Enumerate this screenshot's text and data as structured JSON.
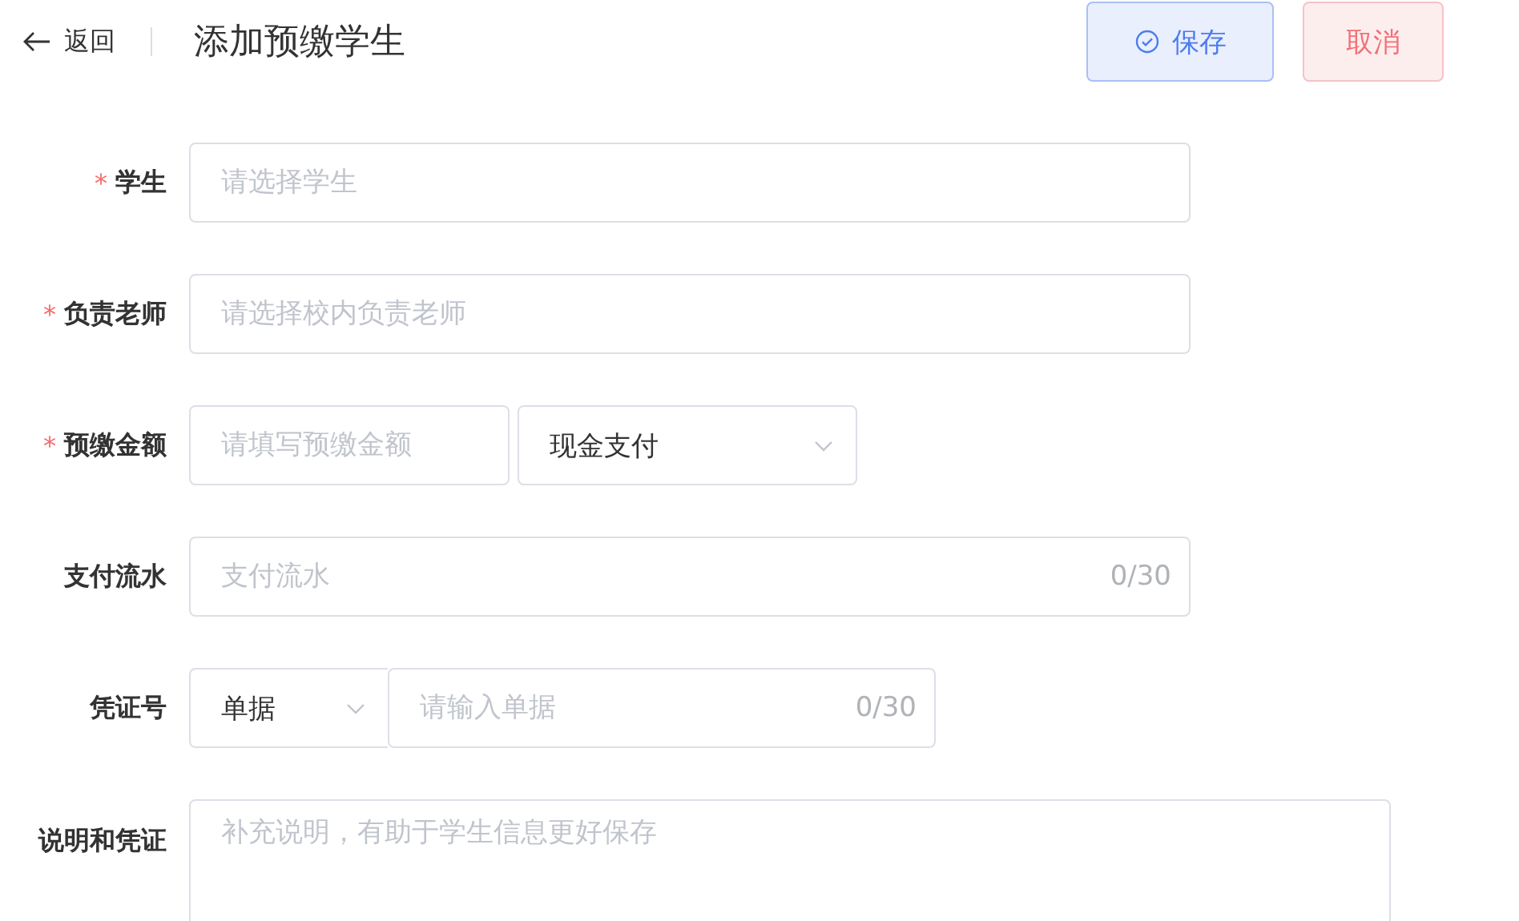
{
  "header": {
    "back": "返回",
    "title": "添加预缴学生",
    "buttons": [
      {
        "label": "保存",
        "kind": "primary"
      },
      {
        "label": "取消",
        "kind": "danger"
      }
    ]
  },
  "fields": [
    {
      "label": "学生",
      "mark": "*",
      "kind": "input",
      "placeholder": "请选择学生"
    },
    {
      "label": "负责老师",
      "mark": "*",
      "kind": "input",
      "placeholder": "请选择校内负责老师"
    },
    {
      "label": "预缴金额",
      "mark": "*",
      "kind": "amount",
      "placeholder": "请填写预缴金额",
      "select": "现金支付"
    },
    {
      "label": "支付流水",
      "kind": "counter",
      "placeholder": "支付流水",
      "count": "0/30"
    },
    {
      "label": "凭证号",
      "kind": "select-counter",
      "select": "单据",
      "placeholder": "请输入单据",
      "count": "0/30"
    },
    {
      "label": "说明和凭证",
      "kind": "textarea",
      "placeholder": "补充说明，有助于学生信息更好保存"
    }
  ]
}
